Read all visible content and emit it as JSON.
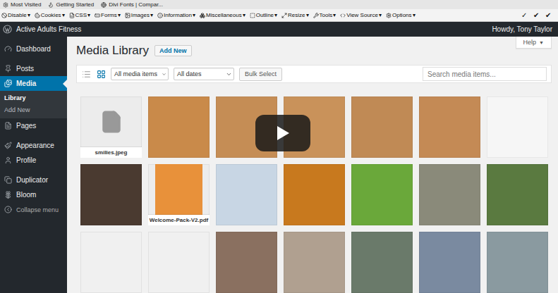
{
  "bookmarks": [
    {
      "label": "Most Visited"
    },
    {
      "label": "Getting Started"
    },
    {
      "label": "Divi Fonts | Compar..."
    }
  ],
  "devtoolbar": {
    "menus": [
      "Disable",
      "Cookies",
      "CSS",
      "Forms",
      "Images",
      "Information",
      "Miscellaneous",
      "Outline",
      "Resize",
      "Tools",
      "View Source",
      "Options"
    ],
    "caret": "▾",
    "marks": [
      "✓",
      "✔",
      "✔"
    ]
  },
  "adminbar": {
    "site": "Active Adults Fitness",
    "greeting": "Howdy, Tony Taylor"
  },
  "sidebar": {
    "groups": [
      [
        {
          "label": "Dashboard",
          "selected": false
        }
      ],
      [
        {
          "label": "Posts",
          "selected": false
        },
        {
          "label": "Media",
          "selected": true,
          "submenu": [
            {
              "label": "Library",
              "selected": true
            },
            {
              "label": "Add New",
              "selected": false
            }
          ]
        },
        {
          "label": "Pages",
          "selected": false
        }
      ],
      [
        {
          "label": "Appearance",
          "selected": false
        },
        {
          "label": "Profile",
          "selected": false
        }
      ],
      [
        {
          "label": "Duplicator",
          "selected": false
        },
        {
          "label": "Bloom",
          "selected": false
        }
      ]
    ],
    "collapse": "Collapse menu"
  },
  "page": {
    "title": "Media Library",
    "add_new": "Add New",
    "help": "Help",
    "help_caret": "▼"
  },
  "toolbar": {
    "views": [
      {
        "kind": "list",
        "selected": false
      },
      {
        "kind": "grid",
        "selected": true
      }
    ],
    "filters": [
      {
        "value": "All media items"
      },
      {
        "value": "All dates"
      }
    ],
    "bulk": "Bulk Select",
    "search_placeholder": "Search media items..."
  },
  "media": [
    {
      "kind": "file",
      "label": "smilies.jpeg"
    },
    {
      "kind": "image",
      "color": "#c98a4a"
    },
    {
      "kind": "image",
      "color": "#c58d55"
    },
    {
      "kind": "image",
      "color": "#c9925a"
    },
    {
      "kind": "image",
      "color": "#c08a55"
    },
    {
      "kind": "image",
      "color": "#c48a55"
    },
    {
      "kind": "image",
      "color": "#f6f6f6"
    },
    {
      "kind": "image",
      "color": "#4a3a30"
    },
    {
      "kind": "document",
      "label": "Welcome-Pack-V2.pdf",
      "color": "#e8913a"
    },
    {
      "kind": "image",
      "color": "#c8d6e4"
    },
    {
      "kind": "image",
      "color": "#c8791e"
    },
    {
      "kind": "image",
      "color": "#6aa83a"
    },
    {
      "kind": "image",
      "color": "#8a8a7a"
    },
    {
      "kind": "image",
      "color": "#5a7a40"
    },
    {
      "kind": "image",
      "color": "#f0f0f0"
    },
    {
      "kind": "image",
      "color": "#f0f0f0"
    },
    {
      "kind": "image",
      "color": "#8a7060"
    },
    {
      "kind": "image",
      "color": "#b0a090"
    },
    {
      "kind": "image",
      "color": "#6a7a6a"
    },
    {
      "kind": "image",
      "color": "#7a8aa0"
    },
    {
      "kind": "image",
      "color": "#8a9aa0"
    }
  ],
  "video_overlay": {
    "visible": true
  }
}
